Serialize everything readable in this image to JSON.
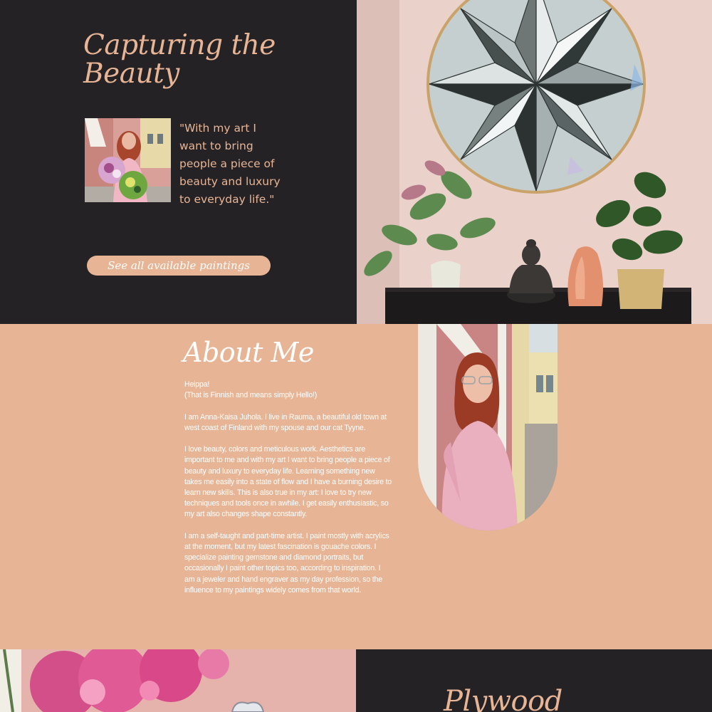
{
  "hero": {
    "title": "Capturing the Beauty",
    "quote": "\"With my art I want to bring people a piece of beauty and luxury to everyday life.\"",
    "button_label": "See all available paintings",
    "colors": {
      "background": "#252226",
      "accent": "#e7b595"
    }
  },
  "about": {
    "title": "About Me",
    "paragraphs": [
      "Heippa!\n(That is Finnish and means simply Hello!)",
      "I am Anna-Kaisa Juhola. I live in Rauma, a beautiful old town at west coast of Finland with my spouse and our cat Tyyne.",
      "I love beauty, colors and meticulous work. Aesthetics are important to me and with my art I want to bring people a piece of beauty and luxury to everyday life. Learning something new takes me easily into a state of flow and I have a burning desire to learn new skills. This is also true in my art: I love to try new techniques and tools once in awhile. I get easily enthusiastic, so my art also changes shape constantly.",
      "I am a self-taught and part-time artist. I paint mostly with acrylics at the moment, but my latest fascination is gouache colors. I specialize painting gemstone and diamond portraits, but occasionally I paint other topics too, according to inspiration. I am a jeweler and hand engraver as my day profession, so the influence to my paintings widely comes from that world."
    ],
    "colors": {
      "background": "#e7b595",
      "text": "#ffffff"
    }
  },
  "plywood": {
    "title": "Plywood"
  }
}
